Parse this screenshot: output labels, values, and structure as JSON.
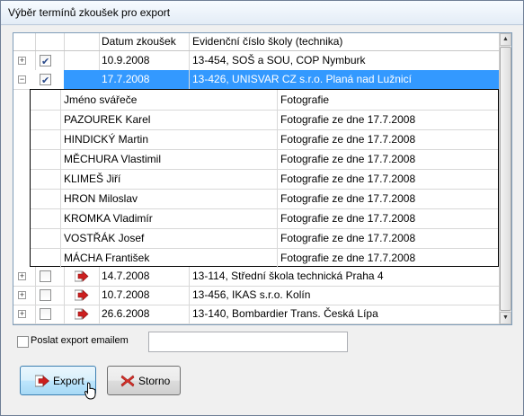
{
  "window": {
    "title": "Výběr termínů zkoušek pro export"
  },
  "grid": {
    "columns": [
      "",
      "",
      "",
      "Datum zkoušek",
      "Evidenční číslo školy (technika)"
    ],
    "rows": [
      {
        "expander": "+",
        "checked": true,
        "icon": "",
        "date": "10.9.2008",
        "school": "13-454, SOŠ a SOU, COP Nymburk",
        "selected": false
      },
      {
        "expander": "−",
        "checked": true,
        "icon": "",
        "date": "17.7.2008",
        "school": "13-426, UNISVAR CZ s.r.o. Planá nad Lužnicí",
        "selected": true
      },
      {
        "expander": "+",
        "checked": false,
        "icon": "export-arrow-icon",
        "date": "14.7.2008",
        "school": "13-114, Střední škola technická Praha 4",
        "selected": false
      },
      {
        "expander": "+",
        "checked": false,
        "icon": "export-arrow-icon",
        "date": "10.7.2008",
        "school": "13-456, IKAS s.r.o. Kolín",
        "selected": false
      },
      {
        "expander": "+",
        "checked": false,
        "icon": "export-arrow-icon",
        "date": "26.6.2008",
        "school": "13-140, Bombardier Trans. Česká Lípa",
        "selected": false
      }
    ],
    "detail": {
      "columns": [
        "Jméno svářeče",
        "Fotografie"
      ],
      "header_foto": "Fotografie",
      "rows": [
        {
          "name": "PAZOUREK Karel",
          "foto": "Fotografie ze dne 17.7.2008"
        },
        {
          "name": "HINDICKÝ Martin",
          "foto": "Fotografie ze dne 17.7.2008"
        },
        {
          "name": "MĚCHURA Vlastimil",
          "foto": "Fotografie ze dne 17.7.2008"
        },
        {
          "name": "KLIMEŠ Jiří",
          "foto": "Fotografie ze dne 17.7.2008"
        },
        {
          "name": "HRON Miloslav",
          "foto": "Fotografie ze dne 17.7.2008"
        },
        {
          "name": "KROMKA Vladimír",
          "foto": "Fotografie ze dne 17.7.2008"
        },
        {
          "name": "VOSTŘÁK Josef",
          "foto": "Fotografie ze dne 17.7.2008"
        },
        {
          "name": "MÁCHA František",
          "foto": "Fotografie ze dne 17.7.2008"
        }
      ]
    }
  },
  "email": {
    "label": "Poslat export emailem",
    "checked": false,
    "value": ""
  },
  "buttons": {
    "export_label": "Export",
    "cancel_label": "Storno"
  },
  "colors": {
    "selection": "#3399ff",
    "export_icon": "#cc1f1f",
    "cancel_icon": "#d9312b"
  }
}
